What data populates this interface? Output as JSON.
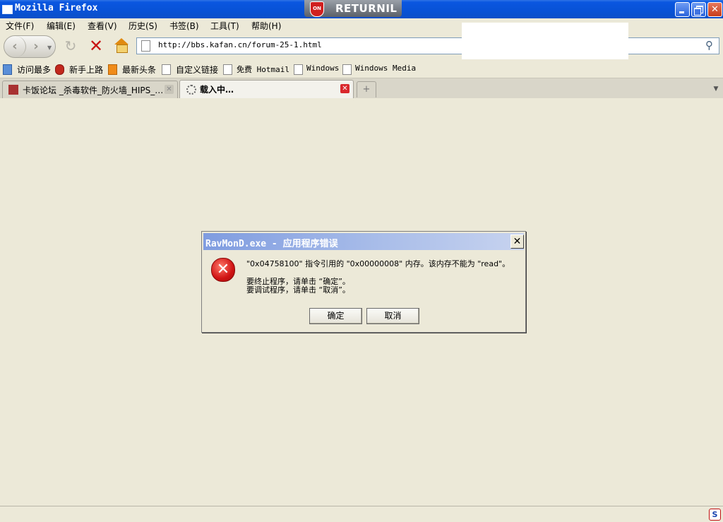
{
  "window": {
    "title": "Mozilla Firefox",
    "returnil": {
      "badge": "ON",
      "label": "RETURNIL"
    },
    "controls": {
      "minimize": "_",
      "maximize": "□",
      "close": "✕"
    }
  },
  "menu": {
    "items": [
      "文件(F)",
      "编辑(E)",
      "查看(V)",
      "历史(S)",
      "书签(B)",
      "工具(T)",
      "帮助(H)"
    ]
  },
  "nav": {
    "back": "‹",
    "forward": "›",
    "reload": "↻",
    "stop": "✕",
    "url": "http://bbs.kafan.cn/forum-25-1.html",
    "go": "⚲"
  },
  "bookmarks": {
    "items": [
      "访问最多",
      "新手上路",
      "最新头条",
      "自定义链接",
      "免费 Hotmail",
      "Windows",
      "Windows Media"
    ]
  },
  "tabs": {
    "items": [
      {
        "favicon": "kafan",
        "label": "卡饭论坛 _杀毒软件_防火墙_HIPS_…",
        "close": "✕"
      },
      {
        "favicon": "loading",
        "label": "载入中…",
        "close": "✕"
      }
    ],
    "new_tab": "+",
    "list": "▼"
  },
  "dialog": {
    "title": "RavMonD.exe - 应用程序错误",
    "close": "✕",
    "icon": "✕",
    "message": "\"0x04758100\" 指令引用的 \"0x00000008\" 内存。该内存不能为 \"read\"。",
    "line2": "要终止程序，请单击 “确定”。",
    "line3": "要调试程序，请单击 “取消”。",
    "ok": "确定",
    "cancel": "取消"
  },
  "status": {
    "icon": "S"
  },
  "colors": {
    "titlebar": "#0a56e0",
    "error": "#d01414",
    "dialog_title": "#7f9ce0"
  }
}
